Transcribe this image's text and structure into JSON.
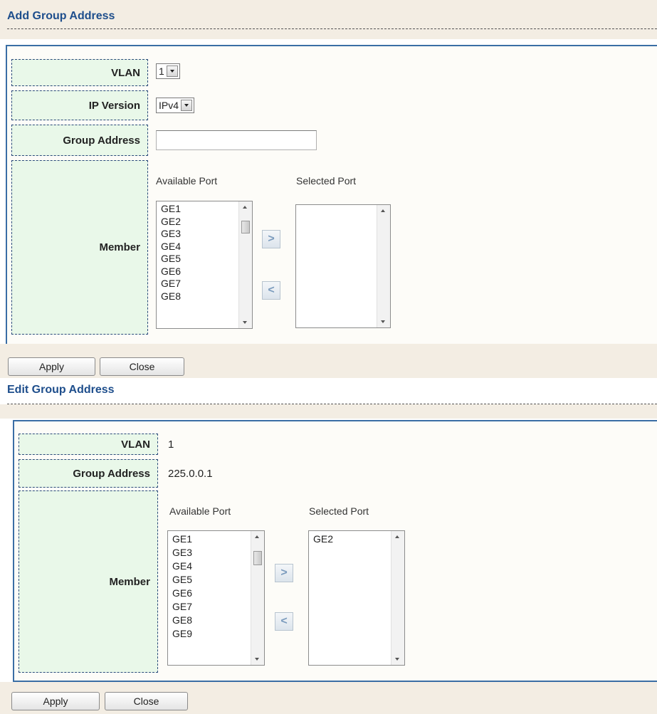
{
  "add": {
    "title": "Add Group Address",
    "vlan_label": "VLAN",
    "vlan_value": "1",
    "ip_version_label": "IP Version",
    "ip_version_value": "IPv4",
    "group_address_label": "Group Address",
    "group_address_value": "",
    "member_label": "Member",
    "available_caption": "Available Port",
    "selected_caption": "Selected Port",
    "available_ports": [
      "GE1",
      "GE2",
      "GE3",
      "GE4",
      "GE5",
      "GE6",
      "GE7",
      "GE8"
    ],
    "selected_ports": [],
    "add_arrow": ">",
    "remove_arrow": "<",
    "apply_label": "Apply",
    "close_label": "Close"
  },
  "edit": {
    "title": "Edit Group Address",
    "vlan_label": "VLAN",
    "vlan_value": "1",
    "group_address_label": "Group Address",
    "group_address_value": "225.0.0.1",
    "member_label": "Member",
    "available_caption": "Available Port",
    "selected_caption": "Selected Port",
    "available_ports": [
      "GE1",
      "GE3",
      "GE4",
      "GE5",
      "GE6",
      "GE7",
      "GE8",
      "GE9"
    ],
    "selected_ports": [
      "GE2"
    ],
    "add_arrow": ">",
    "remove_arrow": "<",
    "apply_label": "Apply",
    "close_label": "Close"
  },
  "colors": {
    "title_blue": "#1e4e8c",
    "label_green": "#e9f8e9",
    "band_beige": "#f3ede3",
    "panel_border": "#3a6ea5"
  }
}
